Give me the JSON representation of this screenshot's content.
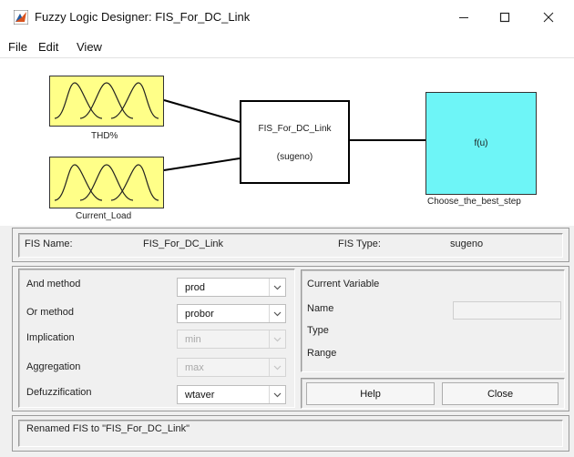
{
  "window": {
    "title": "Fuzzy Logic Designer: FIS_For_DC_Link",
    "controls": [
      "minimize-icon",
      "maximize-icon",
      "close-icon"
    ]
  },
  "menu": {
    "items": [
      "File",
      "Edit",
      "View"
    ]
  },
  "diagram": {
    "inputs": [
      {
        "label": "THD%"
      },
      {
        "label": "Current_Load"
      }
    ],
    "fis": {
      "name": "FIS_For_DC_Link",
      "type": "(sugeno)"
    },
    "output": {
      "function": "f(u)",
      "label": "Choose_the_best_step"
    },
    "colors": {
      "input_fill": "#ffff88",
      "output_fill": "#6ef5f7"
    }
  },
  "info": {
    "fis_name_label": "FIS Name:",
    "fis_name_value": "FIS_For_DC_Link",
    "fis_type_label": "FIS Type:",
    "fis_type_value": "sugeno"
  },
  "methods": [
    {
      "label": "And method",
      "value": "prod",
      "enabled": true
    },
    {
      "label": "Or method",
      "value": "probor",
      "enabled": true
    },
    {
      "label": "Implication",
      "value": "min",
      "enabled": false
    },
    {
      "label": "Aggregation",
      "value": "max",
      "enabled": false
    },
    {
      "label": "Defuzzification",
      "value": "wtaver",
      "enabled": true
    }
  ],
  "current_variable": {
    "title": "Current Variable",
    "name_label": "Name",
    "name_value": "",
    "type_label": "Type",
    "range_label": "Range"
  },
  "buttons": {
    "help": "Help",
    "close": "Close"
  },
  "status": {
    "message": "Renamed FIS to \"FIS_For_DC_Link\""
  }
}
